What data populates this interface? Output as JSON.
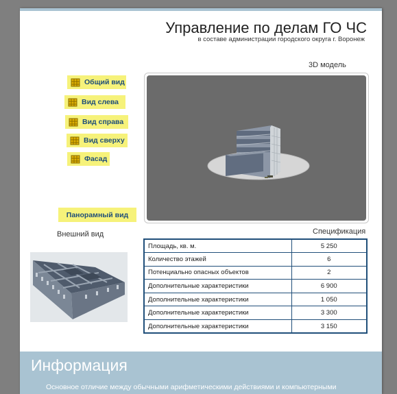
{
  "header": {
    "title": "Управление по делам ГО ЧС",
    "subtitle": "в составе администрации городского округа г. Воронеж"
  },
  "viewer": {
    "label": "3D модель"
  },
  "view_buttons": [
    {
      "label": "Общий вид"
    },
    {
      "label": "Вид слева"
    },
    {
      "label": "Вид справа"
    },
    {
      "label": "Вид сверху"
    },
    {
      "label": "Фасад"
    }
  ],
  "panorama_button": {
    "label": "Панорамный вид"
  },
  "exterior": {
    "label": "Внешний вид"
  },
  "spec": {
    "label": "Спецификация",
    "rows": [
      {
        "name": "Площадь, кв. м.",
        "value": "5 250"
      },
      {
        "name": "Количество этажей",
        "value": "6"
      },
      {
        "name": "Потенциально опасных объектов",
        "value": "2"
      },
      {
        "name": "Дополнительные характеристики",
        "value": "6 900"
      },
      {
        "name": "Дополнительные характеристики",
        "value": "1 050"
      },
      {
        "name": "Дополнительные характеристики",
        "value": "3 300"
      },
      {
        "name": "Дополнительные характеристики",
        "value": "3 150"
      }
    ]
  },
  "info": {
    "title": "Информация",
    "text": "Основное отличие между обычными арифметическими действиями и компьютерными"
  },
  "colors": {
    "button_bg": "#f6f27a",
    "button_text": "#1f4e79",
    "info_band": "#a9c3d2",
    "viewer_bg": "#6b6b6b",
    "table_border": "#1f4e79"
  }
}
